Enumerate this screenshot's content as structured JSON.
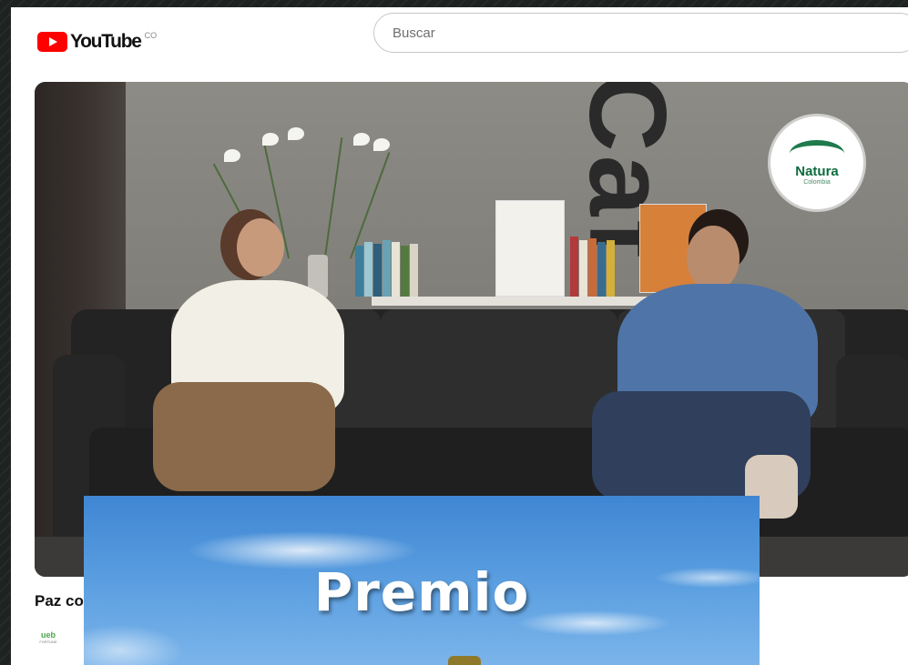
{
  "header": {
    "logo_text": "YouTube",
    "country_code": "CO",
    "search_placeholder": "Buscar"
  },
  "video": {
    "badge_word": "Natura",
    "badge_sub": "Colombia",
    "title": "Paz co",
    "channel_avatar_text": "ueb",
    "channel_avatar_sub": "FORTUNE"
  },
  "overlay": {
    "title": "Premio"
  },
  "colors": {
    "youtube_red": "#ff0000",
    "sky_blue": "#4a93d9",
    "natura_green": "#0c6b3c"
  },
  "icons": {
    "logo": "youtube-play-icon"
  }
}
